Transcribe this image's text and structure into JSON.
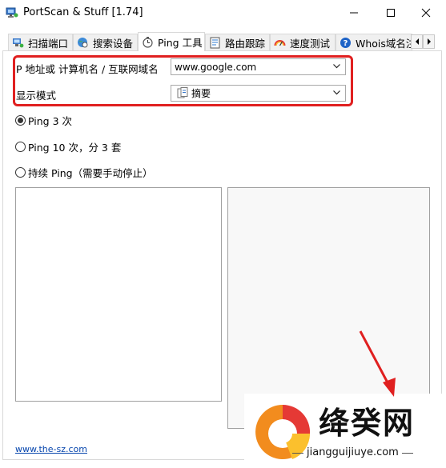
{
  "window": {
    "title": "PortScan & Stuff [1.74]",
    "buttons": {
      "minimize": "minimize-icon",
      "maximize": "maximize-icon",
      "close": "close-icon"
    }
  },
  "tabs": [
    {
      "label": "扫描端口",
      "icon": "port-scan-icon"
    },
    {
      "label": "搜索设备",
      "icon": "globe-search-icon"
    },
    {
      "label": "Ping 工具",
      "icon": "stopwatch-icon",
      "active": true
    },
    {
      "label": "路由跟踪",
      "icon": "route-icon"
    },
    {
      "label": "速度测试",
      "icon": "gauge-icon"
    },
    {
      "label": "Whois域名注",
      "icon": "help-icon"
    }
  ],
  "form": {
    "host_label": "P 地址或 计算机名 / 互联网域名",
    "host_value": "www.google.com",
    "mode_label": "显示模式",
    "mode_value": "摘要"
  },
  "options": [
    {
      "label": "Ping 3 次",
      "selected": true
    },
    {
      "label": "Ping 10 次，分 3 套",
      "selected": false
    },
    {
      "label": "持续 Ping（需要手动停止）",
      "selected": false
    }
  ],
  "footer": {
    "link": "www.the-sz.com"
  },
  "watermark": {
    "name": "绛癸网",
    "url": "jiangguijiuye.com"
  },
  "colors": {
    "highlight": "#e02020",
    "link": "#0645ad"
  }
}
